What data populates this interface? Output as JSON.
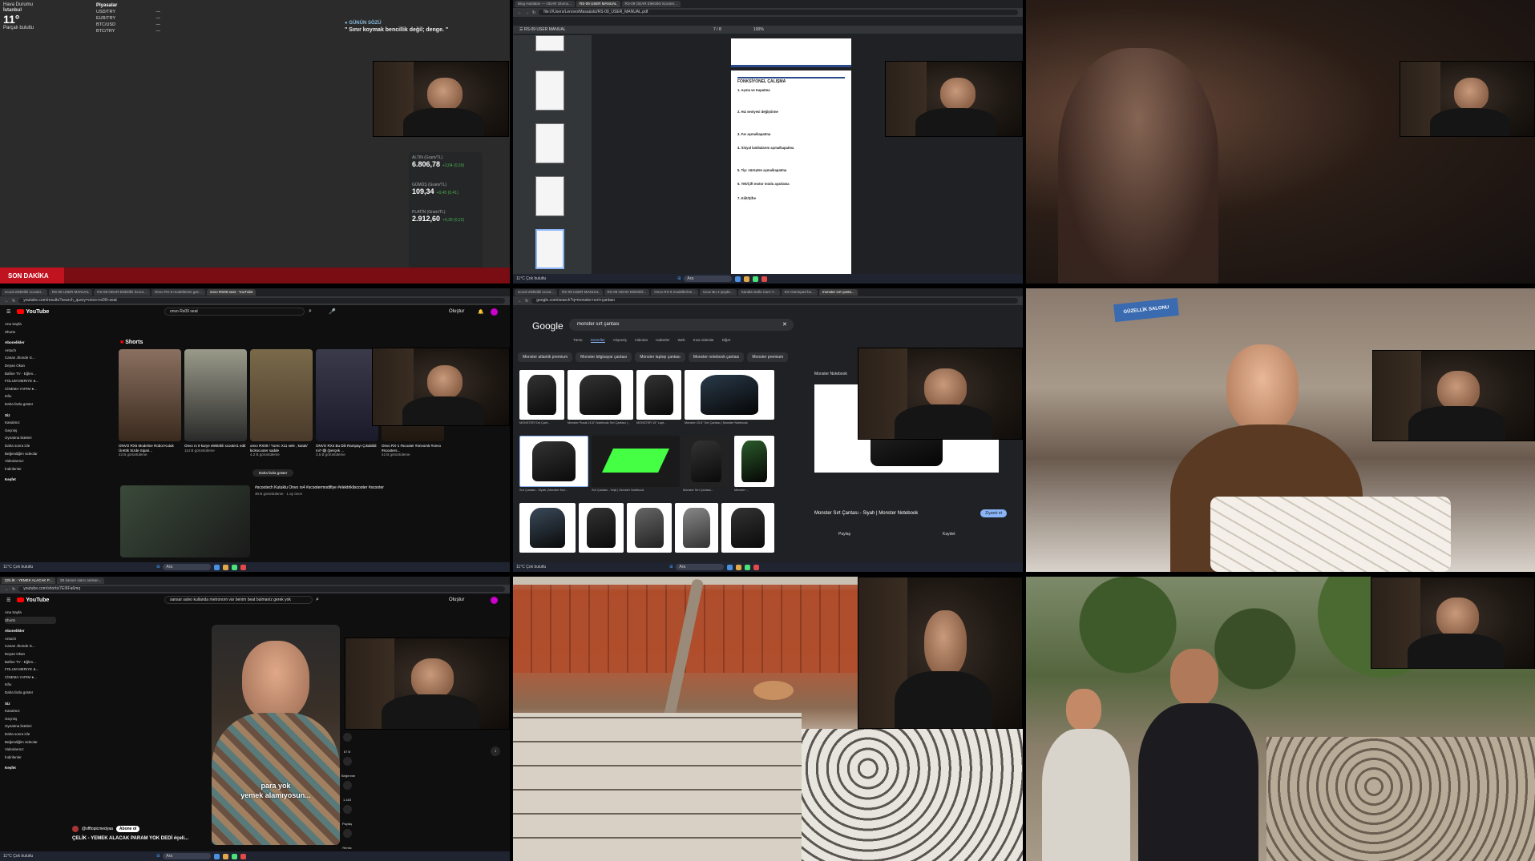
{
  "tile1": {
    "weather": {
      "header": "Hava Durumu",
      "city": "İstanbul",
      "temp": "11°",
      "condition": "Parçalı bulutlu"
    },
    "markets": {
      "title": "Piyasalar",
      "rows": [
        {
          "pair": "USD/TRY",
          "val": "—"
        },
        {
          "pair": "EUR/TRY",
          "val": "—"
        },
        {
          "pair": "BTC/USD",
          "val": "—"
        },
        {
          "pair": "BTC/TRY",
          "val": "—"
        }
      ]
    },
    "quote": {
      "label": "GÜNÜN SÖZÜ",
      "text": "\" Sınır koymak bencillik değil; denge. \""
    },
    "tickers": [
      {
        "name": "ALTIN (Gram/TL)",
        "price": "6.806,78",
        "chg": "+3,04 (0,39)"
      },
      {
        "name": "GÜMÜŞ (Gram/TL)",
        "price": "109,34",
        "chg": "+0,45 (0,41)"
      },
      {
        "name": "PLATİN (Gram/TL)",
        "price": "2.912,60",
        "chg": "+6,39 (0,22)"
      }
    ],
    "breaking": "SON DAKİKA"
  },
  "tile2": {
    "tabs": [
      "Bing Haritaları — ODAR Otomo...",
      "RS-09 USER MANUAL",
      "RS-09 ODAR Elektrikli Scooter..."
    ],
    "url": "file:///Users/Lenovo/Masaüstü/RS-09_USER_MANUAL.pdf",
    "doc_title": "RS-09 USER MANUAL",
    "page_info": "7 / 8",
    "zoom": "100%",
    "page_heading": "FONKSİYONEL ÇALIŞMA",
    "sections": [
      "1. Açma ve Kapatma",
      "2. Hız seviyesi değiştirme",
      "3. Far açma/kapatma",
      "4. Sinyal lambalarını açma/kapatma",
      "5. Tip: sürüşten açma/kapatma",
      "6. Tek/Çift motor modu ayarlama",
      "7. Kilit/Şifre"
    ]
  },
  "tile4": {
    "tabs": [
      "scooti elektrikli scooter...",
      "RS-09 USER MANUAL",
      "RS-09 ODAR Elektrikli Scoot...",
      "Onvo RX-9 modellerine göz...",
      "onvo RS09 seat - YouTube"
    ],
    "url": "youtube.com/results?search_query=onvo+rs09+seat",
    "search": "onvo Rs09 seat",
    "logo": "YouTube",
    "create": "Oluştur",
    "side": [
      "Ana Sayfa",
      "Shorts",
      "Abonelikler",
      "Antoch",
      "Canan Jhonde G...",
      "Deyan Okan",
      "Bafine TV - Eğlen...",
      "FOLUM MERIYE &...",
      "CİNEMA YAPIM ●...",
      "Isfuı",
      "Daha fazla göster",
      "Siz",
      "Kanalınız",
      "Geçmiş",
      "Oynatma listeleri",
      "Daha sonra izle",
      "Beğendiğim videolar",
      "Videolarınız",
      "İndirilenler",
      "Keşfet"
    ],
    "shorts_title": "Shorts",
    "shorts": [
      {
        "title": "ONVO RX5 Modeline Robot Kutuk Ürettik Sizde Sipari...",
        "views": "43 B görüntüleme"
      },
      {
        "title": "Onvo rx 9 kurye elektrikli scooter1 edit",
        "views": "114 B görüntüleme"
      },
      {
        "title": "onvo RX09 / Yurec X11 sele , kutuk/ kickscooter sadde",
        "views": "4,2 B görüntüleme"
      },
      {
        "title": "ONVO RX4 Bu Dik Rampayı Çıkabildi mi? 😱 (Şerçek ...",
        "views": "3,5 B görüntüleme"
      },
      {
        "title": "Onvo RX-1 #scooter #onvors5 #onvo #scooters...",
        "views": "42 B görüntüleme"
      }
    ],
    "more": "Daha fazla göster",
    "video_title": "#scootech Kutuklu Onvo rs4 #scootermodifiye #elektrikliscooter #scooter",
    "video_meta": "30 B görüntüleme · 1 ay önce"
  },
  "tile5": {
    "tabs": [
      "scooti elektrikli scoot...",
      "RS-09 USER MANUAL",
      "RS-09 ODAR Elektrikli...",
      "Onvo RX-9 modellerine...",
      "Ucuz Bu 4 şeyde...",
      "Sandia Gallo Cam-Y...",
      "EX Gamepad bu...",
      "monster sırt çanta..."
    ],
    "url": "google.com/search?q=monster+sırt+çantası",
    "logo": "Google",
    "query": "monster sırt çantası",
    "nav": [
      "Tümü",
      "Görseller",
      "Alışveriş",
      "Videolar",
      "Haberler",
      "Web",
      "Kısa videolar",
      "Diğer"
    ],
    "selected_nav": "Görseller",
    "chips": [
      "Monster atlantik premium",
      "Monster bilgisayar çantası",
      "Monster laptop çantası",
      "Monster notebook çantası",
      "Monster premium"
    ],
    "images": [
      {
        "cap": "MONSTER Sırt Çant..."
      },
      {
        "cap": "Monster Pusat 15.6\" Notebook Sırt Çantası |..."
      },
      {
        "cap": "MONSTER 15\" Lapt..."
      },
      {
        "cap": "Monster 15.6\" Sırt Çantası | Monster Notebook"
      },
      {
        "cap": "Sırt Çantası - Siyah | Monster Not..."
      },
      {
        "cap": "Sırt Çantası - Yeşil | Monster Notebook"
      },
      {
        "cap": "Monster Sırt Çantası..."
      },
      {
        "cap": "Monster ..."
      }
    ],
    "panel_source": "Monster Notebook",
    "panel_title": "Monster Sırt Çantası - Siyah | Monster Notebook",
    "panel_btn": "Ziyaret et",
    "panel_actions": [
      "Paylaş",
      "Kaydet"
    ]
  },
  "tile6": {
    "sign": "GÜZELLİK SALONU"
  },
  "tile7": {
    "tabs": [
      "ÇELİK - YEMEK ALACAK P...",
      "2B kanser satıcı asistan..."
    ],
    "url": "youtube.com/shorts/7EI6Fa6mq",
    "search": "sansar salvo kullanda metronom var benim beat bulmaniz gerek yok",
    "logo": "YouTube",
    "create": "Oluştur",
    "side": [
      "Ana Sayfa",
      "Shorts",
      "Abonelikler",
      "Antoch",
      "Canan Jhonde G...",
      "Deyan Okan",
      "Bafine TV - Eğlen...",
      "FOLUM MERIYE &...",
      "CİNEMA YAPIM ●...",
      "Isfuı",
      "Daha fazla göster",
      "Siz",
      "Kanalınız",
      "Geçmiş",
      "Oynatma listeleri",
      "Daha sonra izle",
      "Beğendiğim videolar",
      "Videolarınız",
      "İndirilenler",
      "Keşfet"
    ],
    "subtitle_1": "para yok",
    "subtitle_2": "yemek alamıyosun...",
    "owner": "@offtopicmedyaa",
    "subscribe": "Abone ol",
    "caption": "ÇELİK - YEMEK ALACAK PARAM YOK DEDİ #çeli...",
    "actions": [
      "67 B",
      "Beğenme",
      "1.183",
      "Paylaş",
      "Remix"
    ]
  },
  "taskbar": {
    "search": "Ara",
    "weather": "11°C Çok bulutlu"
  }
}
